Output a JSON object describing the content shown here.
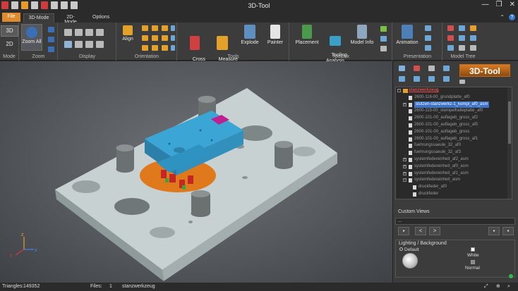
{
  "title_bar": {
    "title": "3D-Tool",
    "minimize": "—",
    "restore": "❐",
    "close": "✕"
  },
  "tabs": {
    "file": "File",
    "tab1": "3D-Mode",
    "tab2": "2D-Mode",
    "tab3": "Options",
    "help": "?"
  },
  "ribbon": {
    "mode": {
      "label": "Mode",
      "btn3d": "3D",
      "btn2d": "2D"
    },
    "zoom": {
      "label": "Zoom",
      "zoom_all": "Zoom All"
    },
    "display": {
      "label": "Display"
    },
    "orientation": {
      "label": "Orientation",
      "align": "Align"
    },
    "tools": {
      "label": "Tools",
      "cross_section": "Cross\nSection",
      "measure_markup": "Measure\nMarkup",
      "explode": "Explode",
      "painter": "Painter"
    },
    "toolbox": {
      "label": "Toolbox",
      "placement": "Placement",
      "tooling_analysis": "Tooling\nAnalysis",
      "model_info": "Model Info"
    },
    "presentation": {
      "label": "Presentation",
      "animation": "Animation"
    },
    "model_tree": {
      "label": "Model Tree"
    }
  },
  "right_panel": {
    "logo": "3D-Tool",
    "tree": [
      {
        "text": "stanzwerkzeug",
        "level": 0,
        "root": true
      },
      {
        "text": "2600-116-00_grundplatte_af0",
        "level": 1
      },
      {
        "text": "stutzen-stanzwerkz-1_kompl_af0_asm",
        "level": 1,
        "selected": true
      },
      {
        "text": "2600-115-00_stempelhalteplatte_af0",
        "level": 1
      },
      {
        "text": "2600-101-00_auflageb_gross_af2",
        "level": 1
      },
      {
        "text": "2600-101-00_auflageb_gross_af0",
        "level": 1
      },
      {
        "text": "2600-101-00_auflageb_gross",
        "level": 1
      },
      {
        "text": "2600-101-00_auflageb_gross_af1",
        "level": 1
      },
      {
        "text": "fuehrungssaeule_32_af0",
        "level": 1
      },
      {
        "text": "fuehrungssaeule_32_af3",
        "level": 1
      },
      {
        "text": "systemfedereinheit_af2_asm",
        "level": 1
      },
      {
        "text": "systemfedereinheit_af0_asm",
        "level": 1
      },
      {
        "text": "systemfedereinheit_af1_asm",
        "level": 1
      },
      {
        "text": "systemfedereinheit_asm",
        "level": 1
      },
      {
        "text": "druckfeder_af0",
        "level": 2
      },
      {
        "text": "druckfeder",
        "level": 2
      },
      {
        "text": "druckfeder_af1",
        "level": 2
      }
    ],
    "custom_views": {
      "label": "Custom Views",
      "value": "...",
      "prev": "<",
      "next": ">"
    },
    "lighting": {
      "label": "Lighting / Background",
      "default": "Default",
      "white": "White",
      "normal": "Normal"
    }
  },
  "status_bar": {
    "triangles_label": "Triangles:",
    "triangles_value": "149352",
    "files_label": "Files:",
    "files_value": "1",
    "file_name": "stanzwerkzeug"
  },
  "colors": {
    "accent_orange": "#e08a2e",
    "selection": "#3c73c8",
    "part_blue": "#3ba6d6",
    "part_orange": "#e07a1a",
    "plate": "#cfd6d6"
  }
}
